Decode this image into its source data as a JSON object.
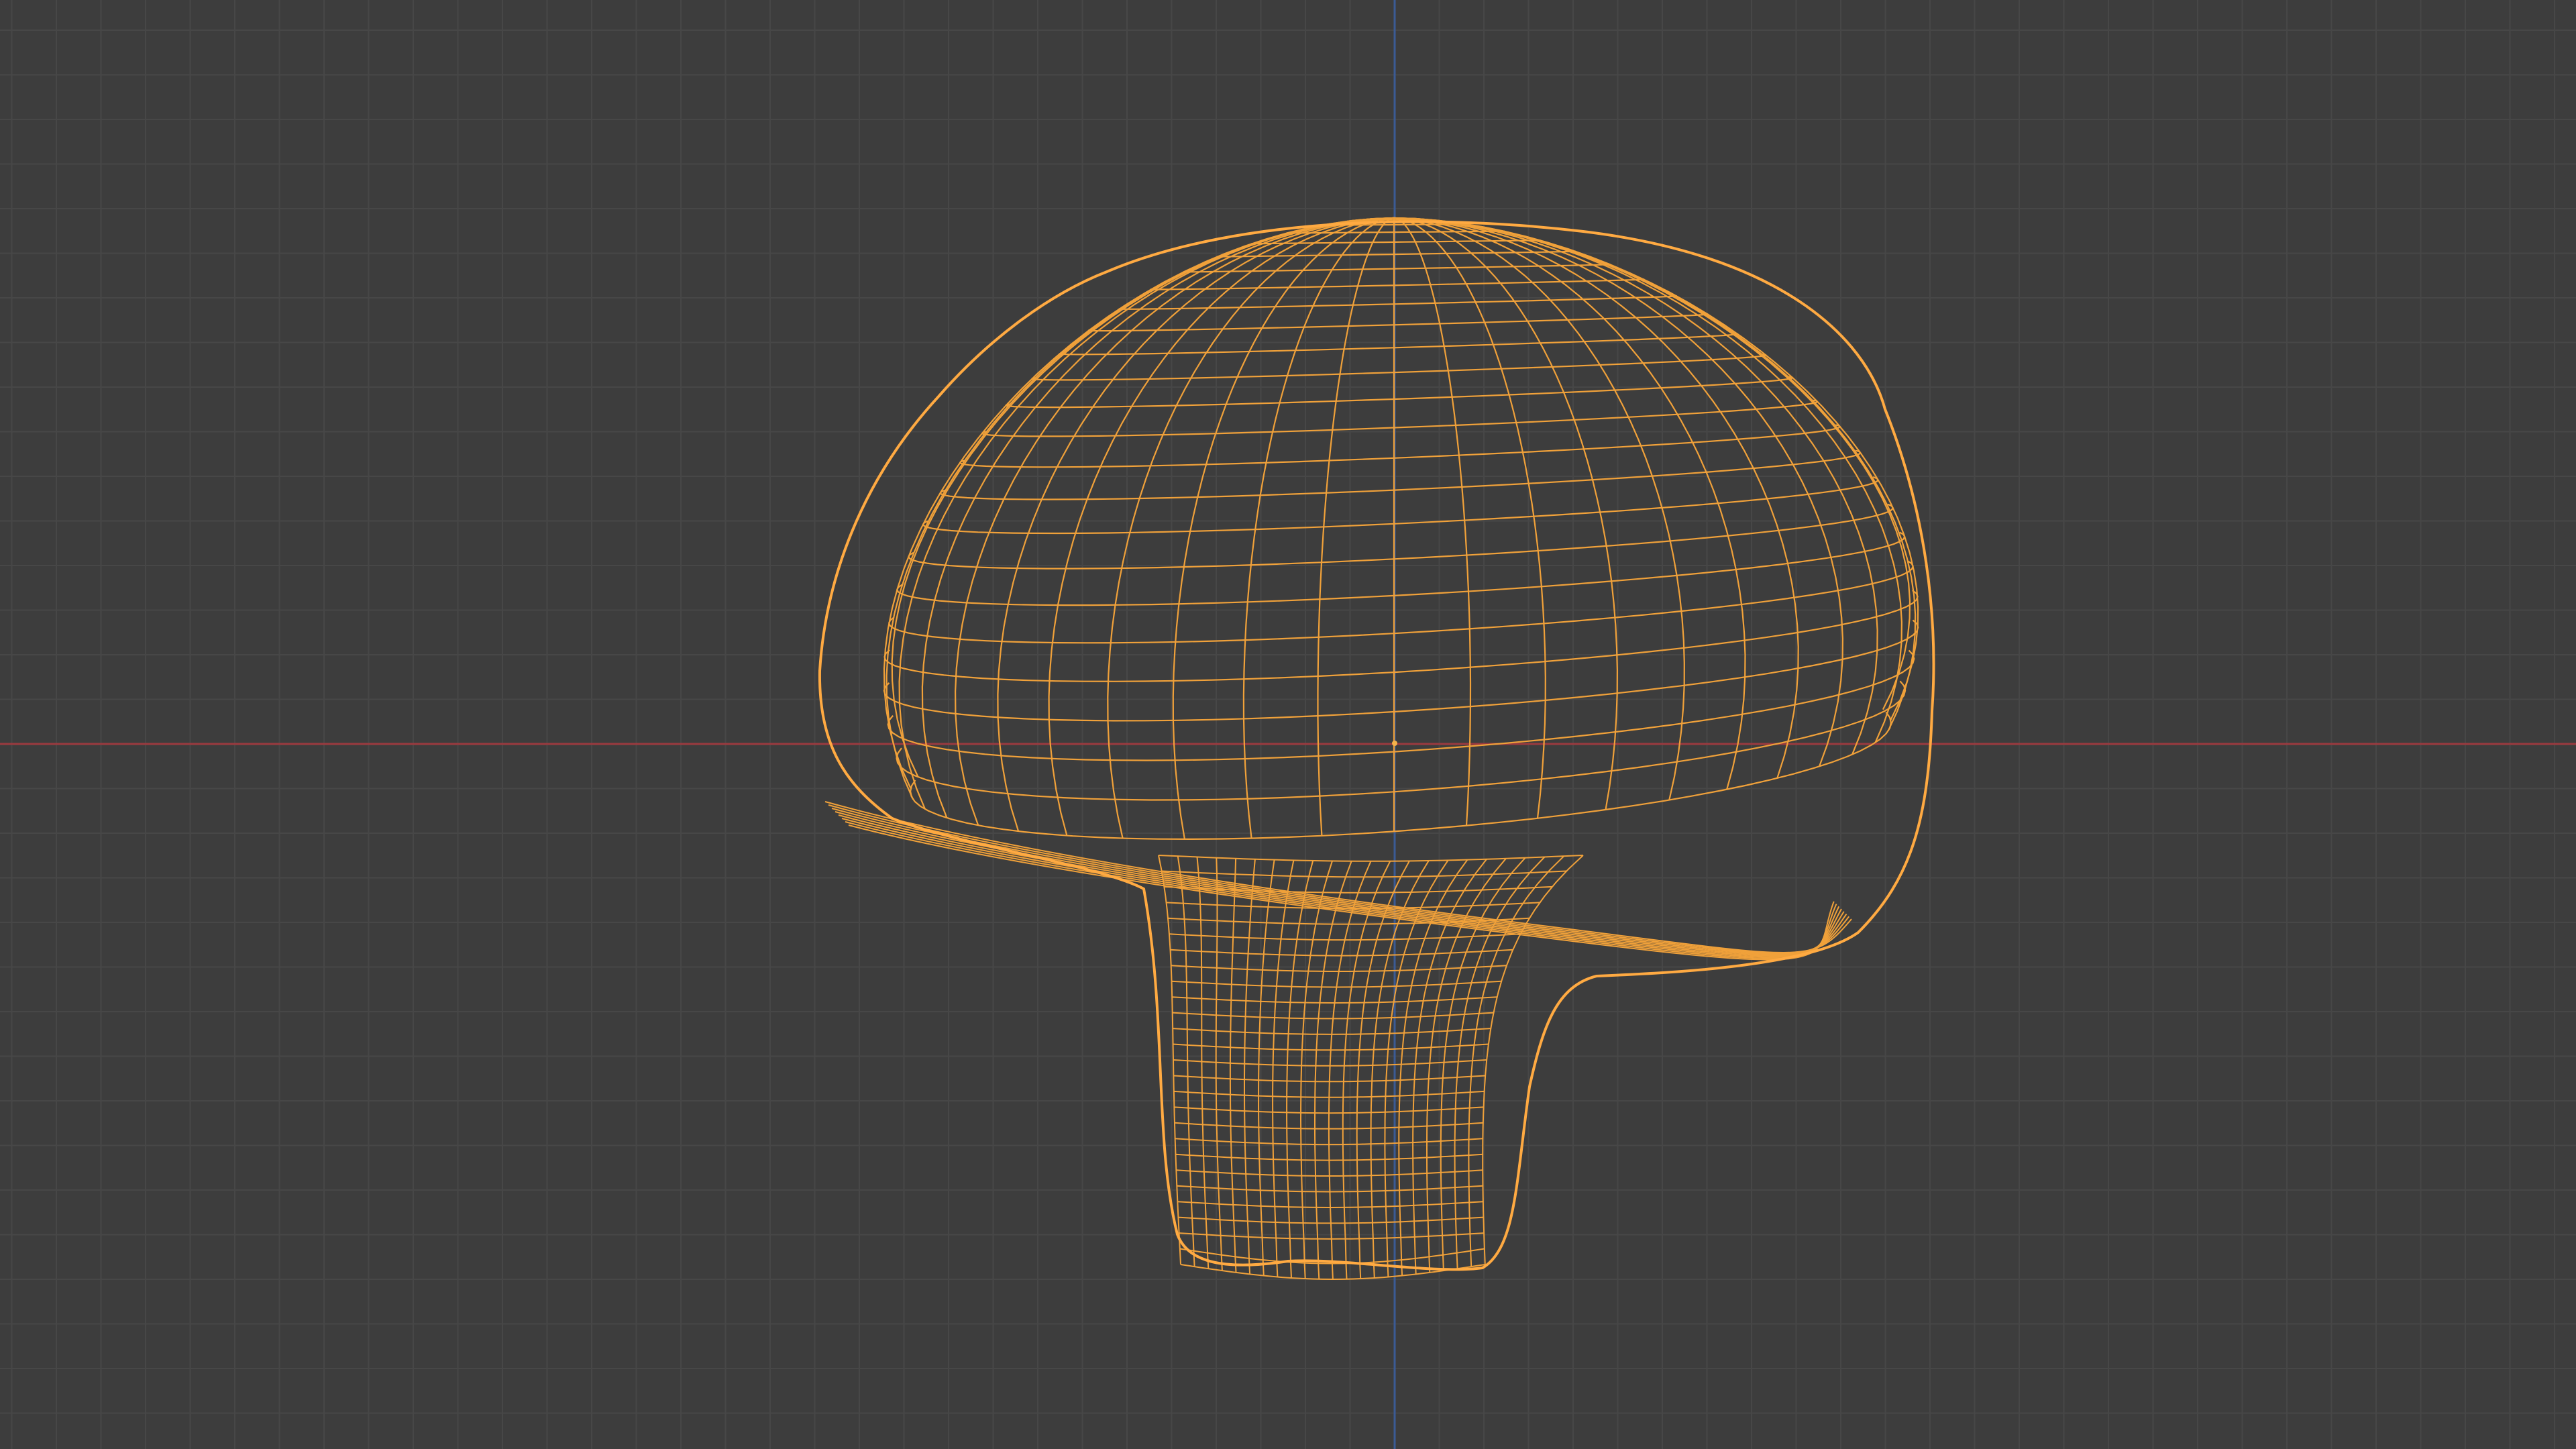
{
  "viewport": {
    "mode": "wireframe",
    "object": "mushroom-mesh",
    "object_selected": true
  },
  "colors": {
    "background": "#3d3d3d",
    "grid_minor": "#474747",
    "grid_major": "#4e4e4e",
    "axis_x": "#9a3a3f",
    "axis_z": "#3b5b95",
    "wire": "#f0a13a",
    "wire_outline": "#ffaa42",
    "origin": "#f5b24a"
  }
}
